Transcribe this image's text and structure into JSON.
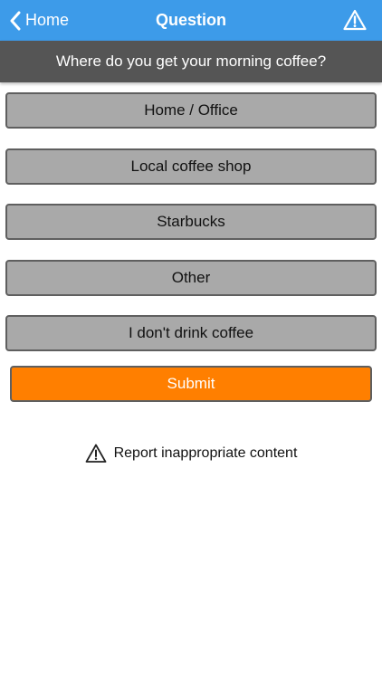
{
  "navbar": {
    "back_label": "Home",
    "title": "Question",
    "back_icon": "chevron-left-icon",
    "alert_icon": "warning-triangle-icon"
  },
  "question": {
    "text": "Where do you get your morning coffee?"
  },
  "options": [
    {
      "label": "Home / Office"
    },
    {
      "label": "Local coffee shop"
    },
    {
      "label": "Starbucks"
    },
    {
      "label": "Other"
    },
    {
      "label": "I don't drink coffee"
    }
  ],
  "submit": {
    "label": "Submit"
  },
  "report": {
    "label": "Report inappropriate content",
    "icon": "warning-triangle-icon"
  },
  "colors": {
    "navbar_bg": "#3d9be9",
    "banner_bg": "#555555",
    "option_bg": "#a9a9a9",
    "submit_bg": "#ff7f00"
  }
}
